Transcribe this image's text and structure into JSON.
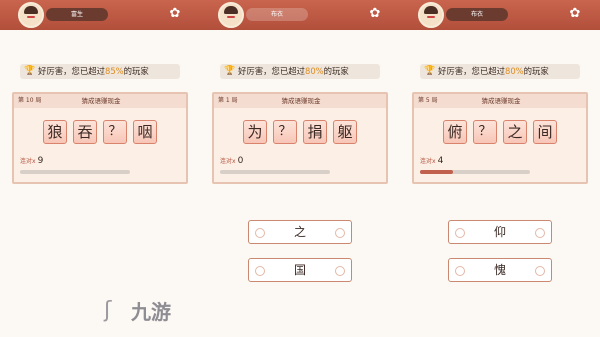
{
  "panels": [
    {
      "header": {
        "player_name": "布衣"
      },
      "praise": {
        "text_before": "好厉害，您已超过",
        "percent": "80%",
        "text_after": "的玩家"
      },
      "card": {
        "level": "第 1 局",
        "mode": "猜成语赚现金",
        "tiles": [
          "为",
          "？",
          "捐",
          "躯"
        ],
        "streak_label": "连对x",
        "streak_value": "0",
        "progress": 0.0
      },
      "answers": [
        "之",
        "国"
      ]
    },
    {
      "header": {
        "player_name": "布衣"
      },
      "praise": {
        "text_before": "好厉害，您已超过",
        "percent": "80%",
        "text_after": "的玩家"
      },
      "card": {
        "level": "第 5 局",
        "mode": "猜成语赚现金",
        "tiles": [
          "俯",
          "？",
          "之",
          "间"
        ],
        "streak_label": "连对x",
        "streak_value": "4",
        "progress": 0.3
      },
      "answers": [
        "仰",
        "愧"
      ]
    },
    {
      "header": {
        "player_name": "富生"
      },
      "praise": {
        "text_before": "好厉害，您已超过",
        "percent": "85%",
        "text_after": "的玩家"
      },
      "card": {
        "level": "第 10 局",
        "mode": "猜成语赚现金",
        "tiles": [
          "狼",
          "吞",
          "？",
          "咽"
        ],
        "streak_label": "连对x",
        "streak_value": "9",
        "progress": 0.0
      },
      "answers": []
    }
  ],
  "watermark": {
    "text": "九游"
  },
  "icons": {
    "avatar": "avatar-icon",
    "settings": "flower-icon",
    "trophy": "trophy-icon",
    "logo": "jiuyou-logo-icon"
  },
  "colors": {
    "header": "#b9543f",
    "tile_border": "#d9836c",
    "highlight": "#e08a1c",
    "progress": "#c0604d"
  }
}
